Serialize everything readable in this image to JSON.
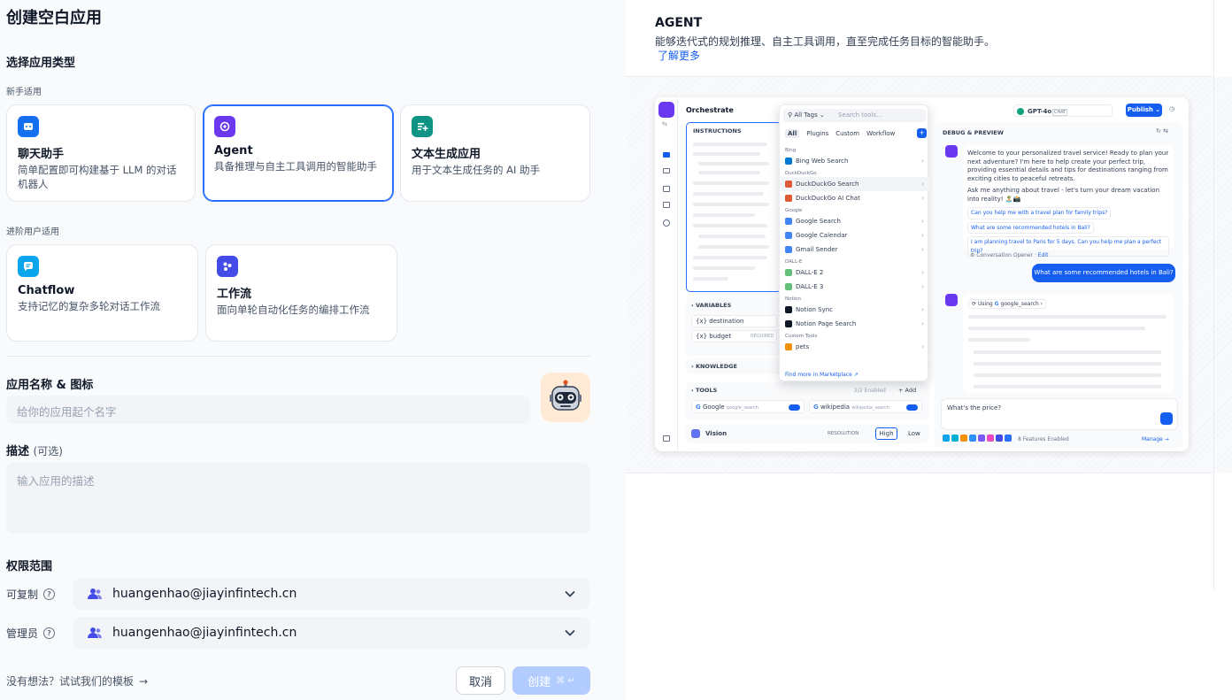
{
  "title": "创建空白应用",
  "section_type": "选择应用类型",
  "beginner_label": "新手适用",
  "advanced_label": "进阶用户适用",
  "cards": [
    {
      "title": "聊天助手",
      "desc": "简单配置即可构建基于 LLM 的对话机器人",
      "color": "#1570ef",
      "icon": "chat-bot-icon"
    },
    {
      "title": "Agent",
      "desc": "具备推理与自主工具调用的智能助手",
      "color": "#6938ef",
      "icon": "agent-icon"
    },
    {
      "title": "文本生成应用",
      "desc": "用于文本生成任务的 AI 助手",
      "color": "#0e9384",
      "icon": "text-generator-icon"
    },
    {
      "title": "Chatflow",
      "desc": "支持记忆的复杂多轮对话工作流",
      "color": "#0ba5ec",
      "icon": "chatflow-icon"
    },
    {
      "title": "工作流",
      "desc": "面向单轮自动化任务的编排工作流",
      "color": "#444ce7",
      "icon": "workflow-icon"
    }
  ],
  "name_section": {
    "label": "应用名称 & 图标",
    "placeholder": "给你的应用起个名字"
  },
  "desc_section": {
    "label": "描述",
    "optional": "(可选)",
    "placeholder": "输入应用的描述"
  },
  "perm_section": {
    "label": "权限范围",
    "rows": [
      {
        "label": "可复制",
        "value": "huangenhao@jiayinfintech.cn"
      },
      {
        "label": "管理员",
        "value": "huangenhao@jiayinfintech.cn"
      }
    ]
  },
  "footer": {
    "hint": "没有想法？试试我们的模板",
    "cancel": "取消",
    "create": "创建",
    "shortcut": "⌘ ↵"
  },
  "agent_panel": {
    "title": "AGENT",
    "desc": "能够迭代式的规划推理、自主工具调用，直至完成任务目标的智能助手。",
    "link": "了解更多"
  },
  "mock": {
    "orchestrate": "Orchestrate",
    "instructions": "INSTRUCTIONS",
    "variables": "VARIABLES",
    "var1": "{x} destination",
    "var2": "{x} budget",
    "required": "REQUIRED",
    "knowledge": "KNOWLEDGE",
    "tools": "TOOLS",
    "tools_enabled": "2/2 Enabled",
    "add": "+ Add",
    "tool1": "Google",
    "tool1_sub": "google_search",
    "tool2": "wikipedia",
    "tool2_sub": "wikipedia_search",
    "vision": "Vision",
    "resolution": "RESOLUTION",
    "high": "High",
    "low": "Low",
    "all_tags": "All Tags",
    "search_tools": "Search tools...",
    "tabs": [
      "All",
      "Plugins",
      "Custom",
      "Workflow"
    ],
    "groups": [
      {
        "name": "Bing",
        "items": [
          "Bing Web Search"
        ]
      },
      {
        "name": "DuckDuckGo",
        "items": [
          "DuckDuckGo Search",
          "DuckDuckGo AI Chat"
        ]
      },
      {
        "name": "Google",
        "items": [
          "Google Search",
          "Google Calendar",
          "Gmail Sender"
        ]
      },
      {
        "name": "DALL-E",
        "items": [
          "DALL-E 2",
          "DALL-E 3"
        ]
      },
      {
        "name": "Notion",
        "items": [
          "Notion Sync",
          "Notion Page Search"
        ]
      },
      {
        "name": "Custom Tools",
        "items": [
          "pets"
        ]
      }
    ],
    "marketplace": "Find more in Marketplace ↗",
    "model": "GPT-4o",
    "chat_badge": "CHAT",
    "publish": "Publish",
    "debug": "DEBUG & PREVIEW",
    "welcome": "Welcome to your personalized travel service! Ready to plan your next adventure? I'm here to help create your perfect trip, providing essential details and tips for destinations ranging from exciting cities to peaceful retreats.",
    "ask": "Ask me anything about travel - let's turn your dream vacation into reality! 🏝️📸",
    "suggestions": [
      "Can you help me with a travel plan for family trips?",
      "What are some recommended hotels in Bali?",
      "I am planning travel to Paris for 5 days. Can you help me plan a perfect trip?"
    ],
    "opener": "Conversation Opener",
    "edit": "Edit",
    "user_msg": "What are some recommended hotels in Bali?",
    "using": "Using",
    "using_tool": "google_search",
    "input": "What's the price?",
    "features": "8 Features Enabled",
    "manage": "Manage →"
  }
}
